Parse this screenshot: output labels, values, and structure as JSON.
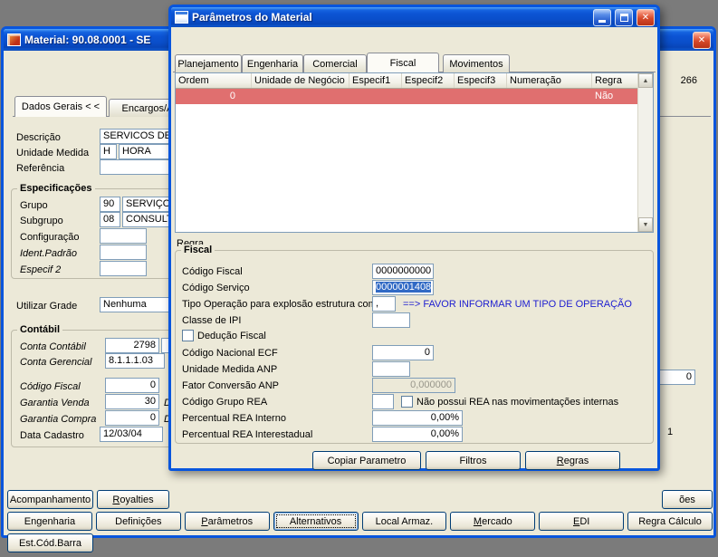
{
  "modal": {
    "title": "Parâmetros do Material",
    "tabs": [
      "Planejamento",
      "Engenharia",
      "Comercial",
      "Fiscal",
      "Movimentos"
    ],
    "grid": {
      "columns": [
        "Ordem",
        "Unidade de Negócio",
        "Especif1",
        "Especif2",
        "Especif3",
        "Numeração",
        "Regra"
      ],
      "row": {
        "ordem": "0",
        "regra": "Não"
      }
    },
    "regra_label": "Regra",
    "group_title": "Fiscal",
    "fiscal": {
      "codigo_fiscal": {
        "label": "Código Fiscal",
        "value": "0000000000"
      },
      "codigo_servico": {
        "label": "Código Serviço",
        "value": "0000001408"
      },
      "tipo_operacao": {
        "label": "Tipo Operação para explosão estrutura com",
        "value": ",",
        "warning": "==> FAVOR INFORMAR UM TIPO DE OPERAÇÃO"
      },
      "classe_ipi": {
        "label": "Classe de IPI",
        "value": ""
      },
      "deducao_fiscal": {
        "label": "Dedução Fiscal"
      },
      "codigo_nacional_ecf": {
        "label": "Código Nacional ECF",
        "value": "0"
      },
      "unidade_medida_anp": {
        "label": "Unidade Medida ANP",
        "value": ""
      },
      "fator_conversao_anp": {
        "label": "Fator Conversão ANP",
        "value": "0,000000"
      },
      "codigo_grupo_rea": {
        "label": "Código Grupo REA",
        "value": "",
        "checkbox_label": "Não possui REA nas movimentações internas"
      },
      "percentual_rea_interno": {
        "label": "Percentual REA Interno",
        "value": "0,00%"
      },
      "percentual_rea_interestadual": {
        "label": "Percentual REA Interestadual",
        "value": "0,00%"
      }
    },
    "buttons": {
      "copiar": "Copiar Parametro",
      "filtros": "Filtros",
      "regras": "Regras"
    }
  },
  "main": {
    "title": "Material: 90.08.0001 - SE",
    "counter": "266",
    "tabs": {
      "dados_gerais": "Dados Gerais < <",
      "encargos": "Encargos/Ad"
    },
    "fields": {
      "descricao": {
        "label": "Descrição",
        "value": "SERVICOS DE"
      },
      "unidade_medida": {
        "label": "Unidade Medida",
        "code": "H",
        "desc": "HORA"
      },
      "referencia": {
        "label": "Referência",
        "value": ""
      },
      "especificacoes_title": "Especificações",
      "grupo": {
        "label": "Grupo",
        "code": "90",
        "desc": "SERVIÇO"
      },
      "subgrupo": {
        "label": "Subgrupo",
        "code": "08",
        "desc": "CONSULT"
      },
      "configuracao": {
        "label": "Configuração",
        "value": ""
      },
      "ident_padrao": {
        "label": "Ident.Padrão",
        "value": ""
      },
      "especif2": {
        "label": "Especif 2",
        "value": ""
      },
      "utilizar_grade": {
        "label": "Utilizar Grade",
        "value": "Nenhuma"
      },
      "contabil_title": "Contábil",
      "conta_contabil": {
        "label": "Conta Contábil",
        "value": "2798"
      },
      "conta_gerencial": {
        "label": "Conta Gerencial",
        "value": "8.1.1.1.03"
      },
      "codigo_fiscal": {
        "label": "Código Fiscal",
        "value": "0"
      },
      "garantia_venda": {
        "label": "Garantia Venda",
        "value": "30",
        "suffix": "Dia"
      },
      "garantia_compra": {
        "label": "Garantia Compra",
        "value": "0",
        "suffix": "Dia"
      },
      "data_cadastro": {
        "label": "Data Cadastro",
        "value": "12/03/04"
      },
      "fragment_value_0": "0",
      "fragment_value_1": "1"
    },
    "buttons": {
      "acompanhamento": "Acompanhamento",
      "royalties": "Royalties",
      "fragment": "ões",
      "engenharia": "Engenharia",
      "definicoes": "Definições",
      "parametros": "Parâmetros",
      "alternativos": "Alternativos",
      "local_armaz": "Local Armaz.",
      "mercado": "Mercado",
      "edi": "EDI",
      "regra_calculo": "Regra Cálculo",
      "est_cod_barra": "Est.Cód.Barra"
    }
  }
}
